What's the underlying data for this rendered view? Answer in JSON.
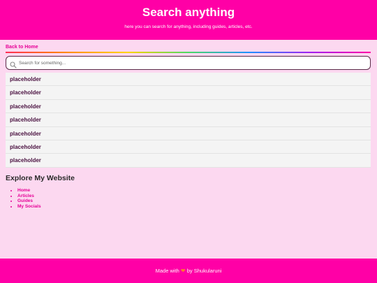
{
  "header": {
    "title": "Search anything",
    "subtitle": "here you can search for anything, including guides, articles, etc."
  },
  "nav": {
    "back_label": "Back to Home"
  },
  "search": {
    "placeholder": "Search for something...",
    "value": ""
  },
  "results": [
    {
      "label": "placeholder"
    },
    {
      "label": "placeholder"
    },
    {
      "label": "placeholder"
    },
    {
      "label": "placeholder"
    },
    {
      "label": "placeholder"
    },
    {
      "label": "placeholder"
    },
    {
      "label": "placeholder"
    }
  ],
  "explore": {
    "title": "Explore My Website",
    "links": [
      {
        "label": "Home"
      },
      {
        "label": "Articles"
      },
      {
        "label": "Guides"
      },
      {
        "label": "My Socials"
      }
    ]
  },
  "footer": {
    "made_with": "Made with",
    "heart_icon": "heart-icon",
    "by": "by Shukularuni"
  },
  "colors": {
    "brand": "#ff00a6",
    "background": "#fcd8f0",
    "link": "#e60096"
  }
}
